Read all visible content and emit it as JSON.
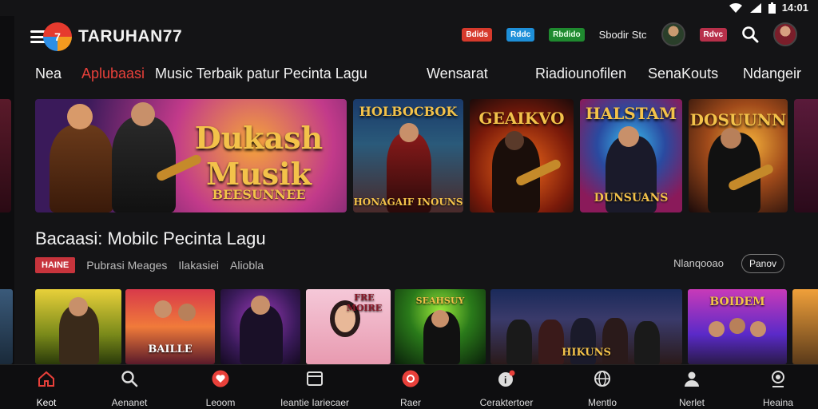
{
  "status_bar": {
    "time": "14:01"
  },
  "header": {
    "brand": "TARUHAN77",
    "chips": [
      "Bdids",
      "Rddc",
      "Rbdido"
    ],
    "text_link": "Sbodir Stc",
    "chip_pink": "Rdvc"
  },
  "nav": {
    "items": [
      {
        "label": "Nea"
      },
      {
        "label": "Aplubaasi",
        "accent": true
      },
      {
        "label": "Music Terbaik patur Pecinta Lagu"
      },
      {
        "label": "Wensarat"
      },
      {
        "label": "Riadiounofilen"
      },
      {
        "label": "SenaKouts"
      },
      {
        "label": "Ndangeir"
      }
    ]
  },
  "banners": [
    {
      "title": "Dukash Musik",
      "sub": "BEESUNNEE"
    },
    {
      "title": "HOLBOCBOK",
      "sub": "HONAGAIF INOUNS"
    },
    {
      "title": "GEAIKVO",
      "sub": ""
    },
    {
      "title": "HALSTAM",
      "sub": "DUNSUANS"
    },
    {
      "title": "DOSUUNN",
      "sub": ""
    }
  ],
  "section": {
    "title": "Bacaasi: Mobilc Pecinta Lagu",
    "tabs": {
      "active": "HAINE",
      "others": [
        "Pubrasi Meages",
        "Ilakasiei",
        "Aliobla"
      ]
    },
    "meta": "Nlanqooao",
    "more_button": "Panov"
  },
  "tiles": [
    {
      "title": ""
    },
    {
      "title": "BAILLE"
    },
    {
      "title": ""
    },
    {
      "title": "FRE MOIRE"
    },
    {
      "title": "SEAHSUY"
    },
    {
      "title": "HIKUNS"
    },
    {
      "title": "BOIDEM"
    }
  ],
  "bottom_nav": [
    {
      "label": "Keot",
      "icon": "home-icon",
      "active": true
    },
    {
      "label": "Aenanet",
      "icon": "search-icon"
    },
    {
      "label": "Leoom",
      "icon": "heart-icon"
    },
    {
      "label": "Ieantie Iariecaer",
      "icon": "library-icon"
    },
    {
      "label": "Raer",
      "icon": "record-icon"
    },
    {
      "label": "Ceraktertoer",
      "icon": "notification-icon"
    },
    {
      "label": "Mentlo",
      "icon": "globe-icon"
    },
    {
      "label": "Nerlet",
      "icon": "profile-icon"
    },
    {
      "label": "Heaina",
      "icon": "account-icon"
    }
  ],
  "colors": {
    "accent": "#e8403a",
    "background": "#141416",
    "gold": "#f3c24a"
  }
}
